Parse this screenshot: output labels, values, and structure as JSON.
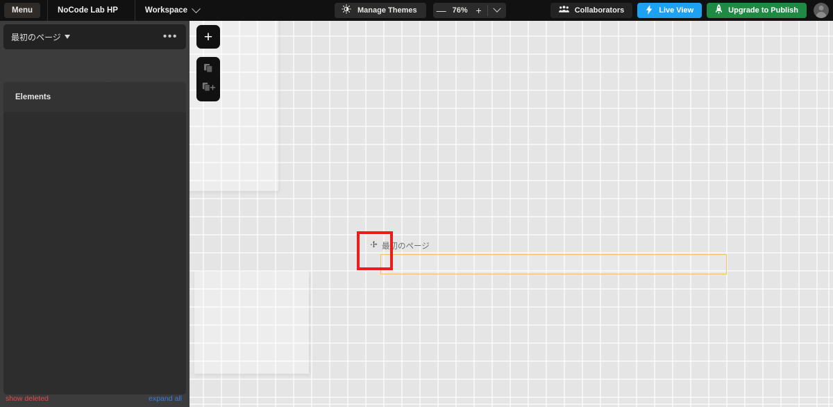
{
  "topbar": {
    "menu_label": "Menu",
    "app_name": "NoCode Lab HP",
    "workspace_label": "Workspace",
    "workspace_icon": "chevron-down-icon",
    "themes_label": "Manage Themes",
    "themes_icon": "brightness-icon",
    "zoom": {
      "minus_label": "—",
      "value": "76%",
      "plus_label": "+",
      "chevron_icon": "chevron-down-icon"
    },
    "collaborators_label": "Collaborators",
    "collaborators_icon": "people-icon",
    "live_view_label": "Live View",
    "live_view_icon": "bolt-icon",
    "upgrade_label": "Upgrade to Publish",
    "upgrade_icon": "rocket-icon",
    "avatar_icon": "user-avatar-icon",
    "colors": {
      "bar_bg": "#111111",
      "live_view_bg": "#1da1f2",
      "upgrade_bg": "#1e8a43"
    }
  },
  "sidebar": {
    "page_selector": {
      "title": "最初のページ",
      "caret_icon": "triangle-down-icon",
      "more_label": "•••"
    },
    "tool_icons": [
      {
        "name": "gear-icon",
        "title": "Settings"
      },
      {
        "name": "user-key-icon",
        "title": "Privacy"
      },
      {
        "name": "broadcast-icon",
        "title": "Responsive"
      },
      {
        "name": "ai-head-code-icon",
        "title": "AI"
      },
      {
        "name": "plugin-icon",
        "title": "Plugins"
      },
      {
        "name": "resize-arrow-icon",
        "title": "Resize"
      }
    ],
    "elements_header": "Elements",
    "footer": {
      "show_deleted": "show deleted",
      "expand_all": "expand all",
      "show_deleted_color": "#e04b4b",
      "expand_all_color": "#3b7ddd"
    },
    "colors": {
      "frame_bg": "#3c3c3c",
      "panel_bg": "#2d2d2d",
      "header_bg": "#333333"
    }
  },
  "canvas": {
    "add_button_label": "+",
    "add_button_icon": "plus-icon",
    "clipboard_icons": [
      {
        "name": "copy-icon",
        "title": "Copy"
      },
      {
        "name": "paste-add-icon",
        "title": "Paste"
      }
    ],
    "selected_element": {
      "move_handle_icon": "move-arrows-icon",
      "label": "最初のページ",
      "outline_color": "#f0c164"
    },
    "annotation": {
      "type": "red-highlight-box",
      "color": "#ee1b1b"
    },
    "grid": {
      "bg_color": "#e5e5e5",
      "line_color": "#ffffff",
      "spacing_px": "26"
    }
  }
}
